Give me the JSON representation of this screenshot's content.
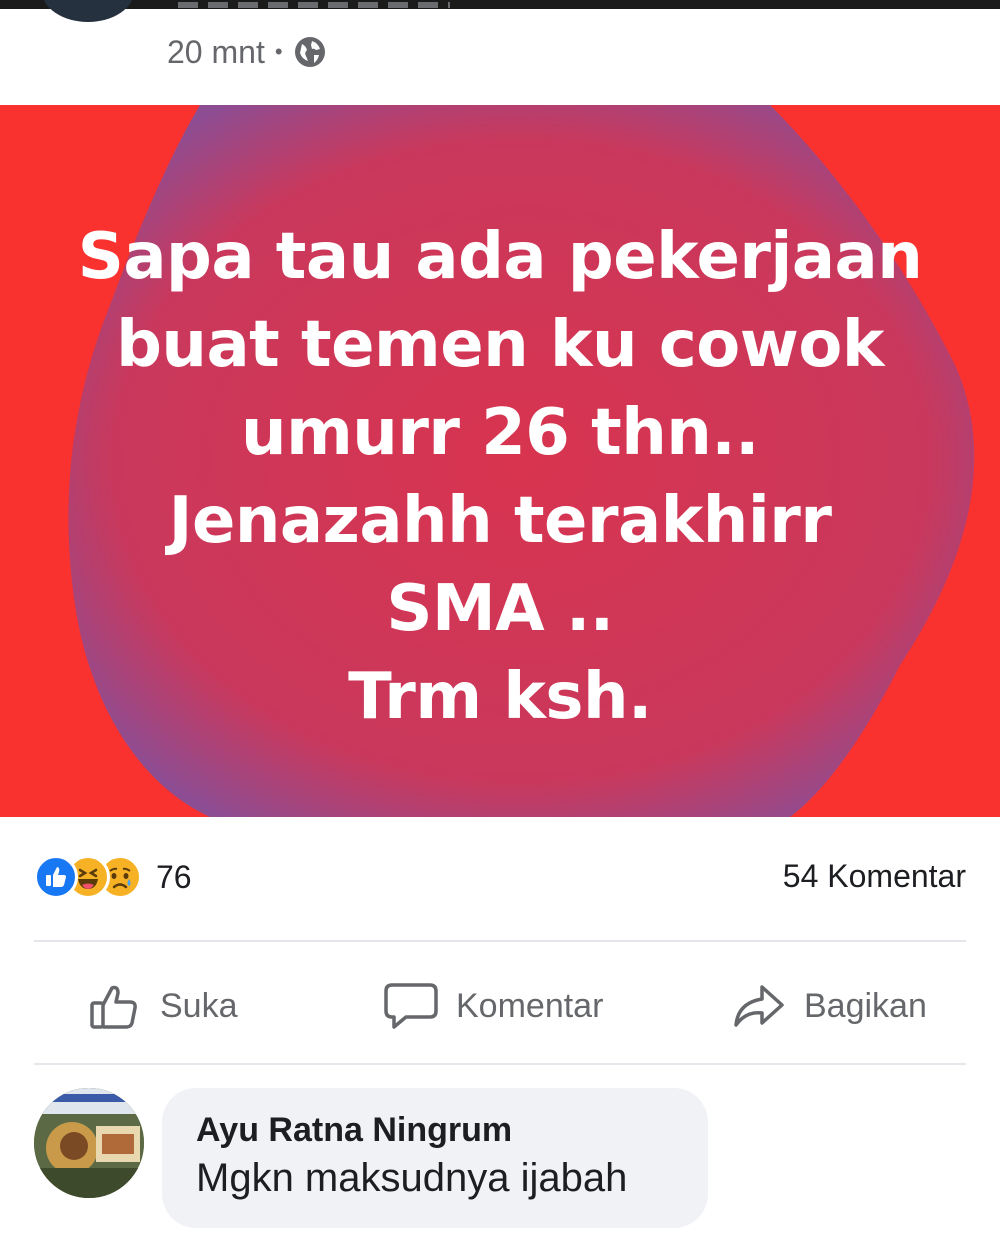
{
  "post": {
    "timestamp": "20 mnt",
    "separator": "•",
    "privacy_icon": "globe-icon",
    "text_lines": [
      "Sapa tau ada pekerjaan",
      "buat temen ku cowok",
      "umurr 26 thn..",
      "Jenazahh terakhirr",
      "SMA ..",
      "Trm ksh."
    ],
    "background_color": "#f9322f",
    "blob_color": "#c8395c",
    "text_color": "#ffffff"
  },
  "stats": {
    "reaction_icons": [
      "like-reaction-icon",
      "haha-reaction-icon",
      "sad-reaction-icon"
    ],
    "reaction_count": "76",
    "comment_count": "54 Komentar"
  },
  "actions": {
    "like_label": "Suka",
    "comment_label": "Komentar",
    "share_label": "Bagikan"
  },
  "comment": {
    "author": "Ayu Ratna Ningrum",
    "text": "Mgkn maksudnya ijabah"
  },
  "colors": {
    "like_blue": "#1877f2",
    "reaction_yellow": "#f7b125",
    "secondary_text": "#65676b",
    "bubble_bg": "#f0f2f5"
  }
}
